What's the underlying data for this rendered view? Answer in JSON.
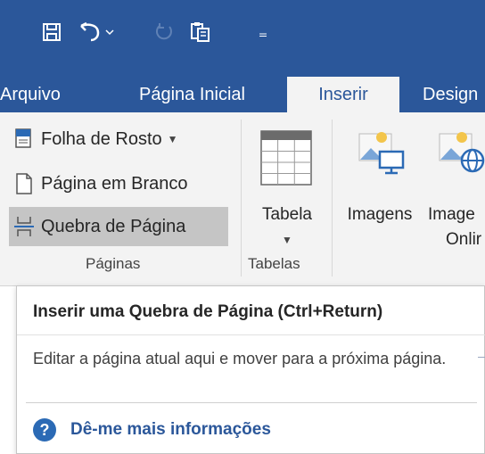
{
  "qat": {
    "icons": [
      "save-icon",
      "undo-icon",
      "redo-icon",
      "clipboard-icon",
      "customize-qat-icon"
    ],
    "more": "₌"
  },
  "tabs": {
    "arquivo": "Arquivo",
    "pagina_inicial": "Página Inicial",
    "inserir": "Inserir",
    "design": "Design"
  },
  "ribbon": {
    "paginas": {
      "folha_de_rosto": "Folha de Rosto",
      "pagina_em_branco": "Página em Branco",
      "quebra_de_pagina": "Quebra de Página",
      "group_label": "Páginas"
    },
    "tabelas": {
      "tabela": "Tabela",
      "group_label": "Tabelas"
    },
    "imagens": "Imagens",
    "imagens_online_line1": "Image",
    "imagens_online_line2": "Onlir"
  },
  "tooltip": {
    "title": "Inserir uma Quebra de Página (Ctrl+Return)",
    "description": "Editar a página atual aqui e mover para a próxima página.",
    "help_link": "Dê-me mais informações",
    "help_icon": "?"
  },
  "colors": {
    "brand": "#2b579a",
    "ribbon_bg": "#f3f3f3",
    "selected_item": "#c5c5c5"
  }
}
